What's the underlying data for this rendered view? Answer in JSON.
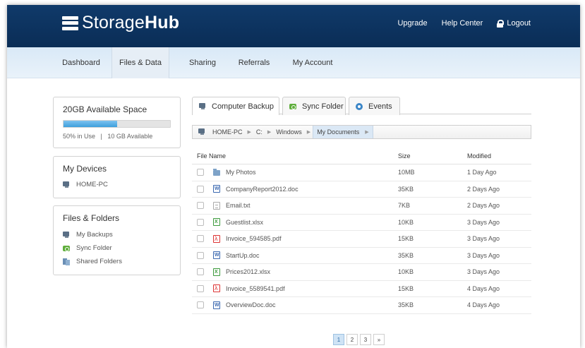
{
  "header": {
    "logo_light": "Storage",
    "logo_bold": "Hub",
    "links": {
      "upgrade": "Upgrade",
      "help": "Help Center",
      "logout": "Logout"
    }
  },
  "nav": {
    "items": [
      "Dashboard",
      "Files & Data",
      "Sharing",
      "Referrals",
      "My Account"
    ],
    "active": "Files & Data"
  },
  "storage": {
    "title": "20GB Available Space",
    "used_fraction": 0.5,
    "in_use": "50% in Use",
    "separator": "|",
    "available": "10 GB Available"
  },
  "devices": {
    "title": "My Devices",
    "items": [
      "HOME-PC"
    ]
  },
  "files_folders": {
    "title": "Files & Folders",
    "items": [
      "My Backups",
      "Sync Folder",
      "Shared Folders"
    ]
  },
  "tabs": {
    "items": [
      "Computer Backup",
      "Sync Folder",
      "Events"
    ],
    "active": "Computer Backup"
  },
  "breadcrumb": [
    "HOME-PC",
    "C:",
    "Windows",
    "My Documents"
  ],
  "table": {
    "headers": {
      "name": "File Name",
      "size": "Size",
      "modified": "Modified"
    },
    "rows": [
      {
        "name": "My Photos",
        "size": "10MB",
        "modified": "1 Day Ago",
        "icon": "folder-icon"
      },
      {
        "name": "CompanyReport2012.doc",
        "size": "35KB",
        "modified": "2 Days Ago",
        "icon": "doc-icon"
      },
      {
        "name": "Email.txt",
        "size": "7KB",
        "modified": "2 Days Ago",
        "icon": "txt-icon"
      },
      {
        "name": "Guestlist.xlsx",
        "size": "10KB",
        "modified": "3 Days Ago",
        "icon": "xlsx-icon"
      },
      {
        "name": "Invoice_594585.pdf",
        "size": "15KB",
        "modified": "3 Days Ago",
        "icon": "pdf-icon"
      },
      {
        "name": "StartUp.doc",
        "size": "35KB",
        "modified": "3 Days Ago",
        "icon": "doc-icon"
      },
      {
        "name": "Prices2012.xlsx",
        "size": "10KB",
        "modified": "3 Days Ago",
        "icon": "xlsx-icon"
      },
      {
        "name": "Invoice_5589541.pdf",
        "size": "15KB",
        "modified": "4 Days Ago",
        "icon": "pdf-icon"
      },
      {
        "name": "OverviewDoc.doc",
        "size": "35KB",
        "modified": "4 Days Ago",
        "icon": "doc-icon"
      }
    ]
  },
  "pagination": {
    "pages": [
      "1",
      "2",
      "3"
    ],
    "active": "1",
    "next": "»"
  },
  "colors": {
    "header": "#0b2f5a",
    "nav": "#dfecf8",
    "progress": "#4aa6df",
    "active_page": "#cfe3f5"
  }
}
